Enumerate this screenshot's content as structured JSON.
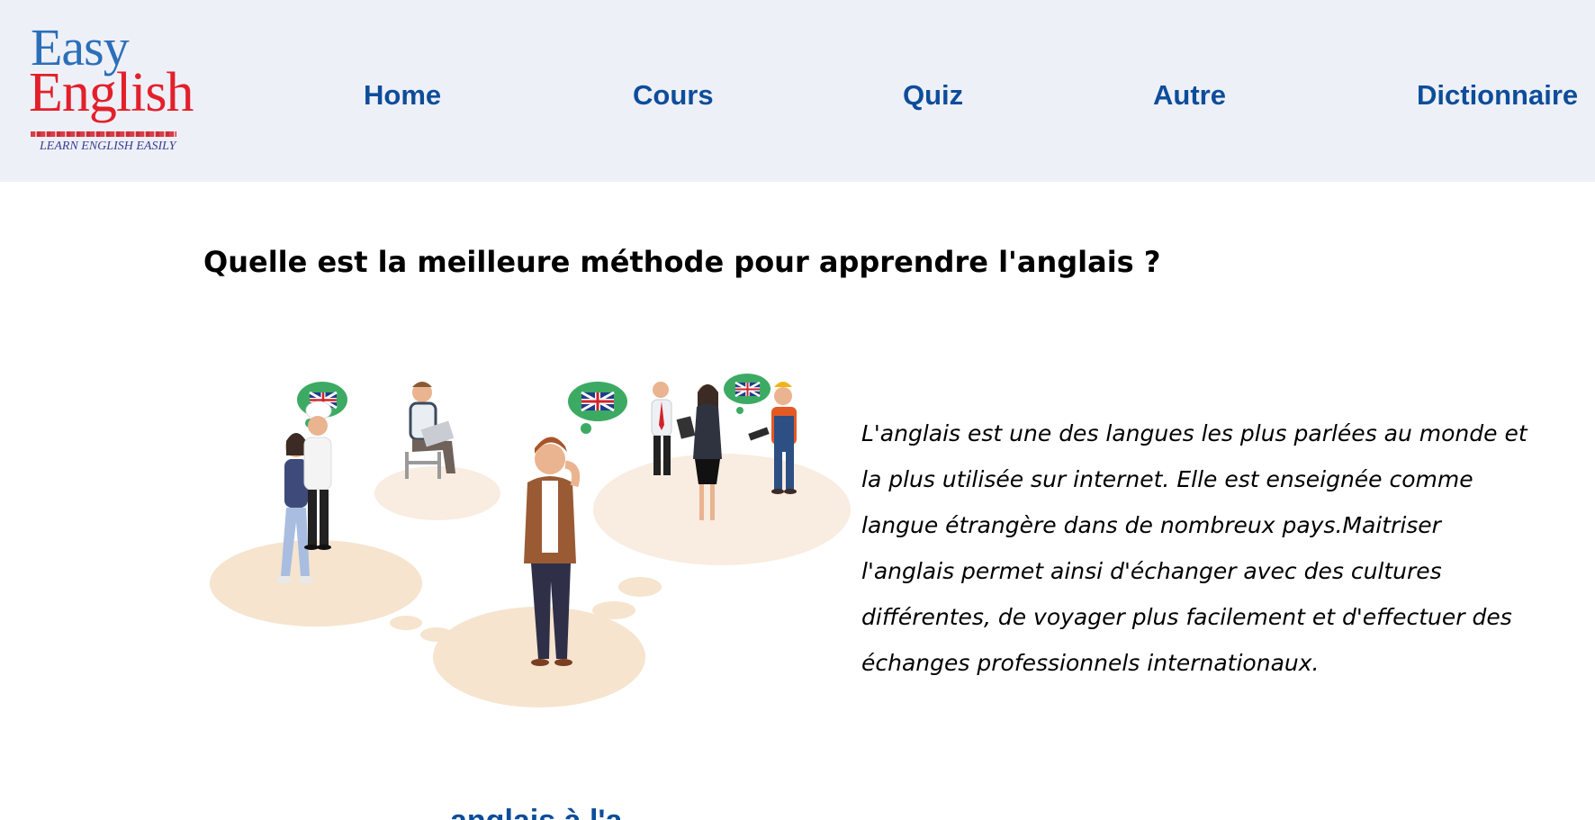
{
  "header": {
    "logo": {
      "line1": "Easy",
      "line2": "English",
      "tagline": "LEARN ENGLISH EASILY"
    },
    "nav": [
      {
        "label": "Home"
      },
      {
        "label": "Cours"
      },
      {
        "label": "Quiz"
      },
      {
        "label": "Autre"
      },
      {
        "label": "Dictionnaire"
      }
    ]
  },
  "main": {
    "title": "Quelle est la meilleure méthode pour apprendre l'anglais ?",
    "paragraph": "L'anglais est une des langues les plus parlées au monde et la plus utilisée sur internet. Elle est enseignée comme langue étrangère dans de nombreux pays.Maitriser l'anglais permet ainsi d'échanger avec des cultures différentes, de voyager plus facilement et d'effectuer des échanges professionnels internationaux.",
    "next_heading_partial": "anglais à l'a"
  },
  "colors": {
    "header_bg": "#eef0f8",
    "nav_link": "#0d4d9a",
    "logo_blue": "#2b6fb8",
    "logo_red": "#e3202a"
  }
}
